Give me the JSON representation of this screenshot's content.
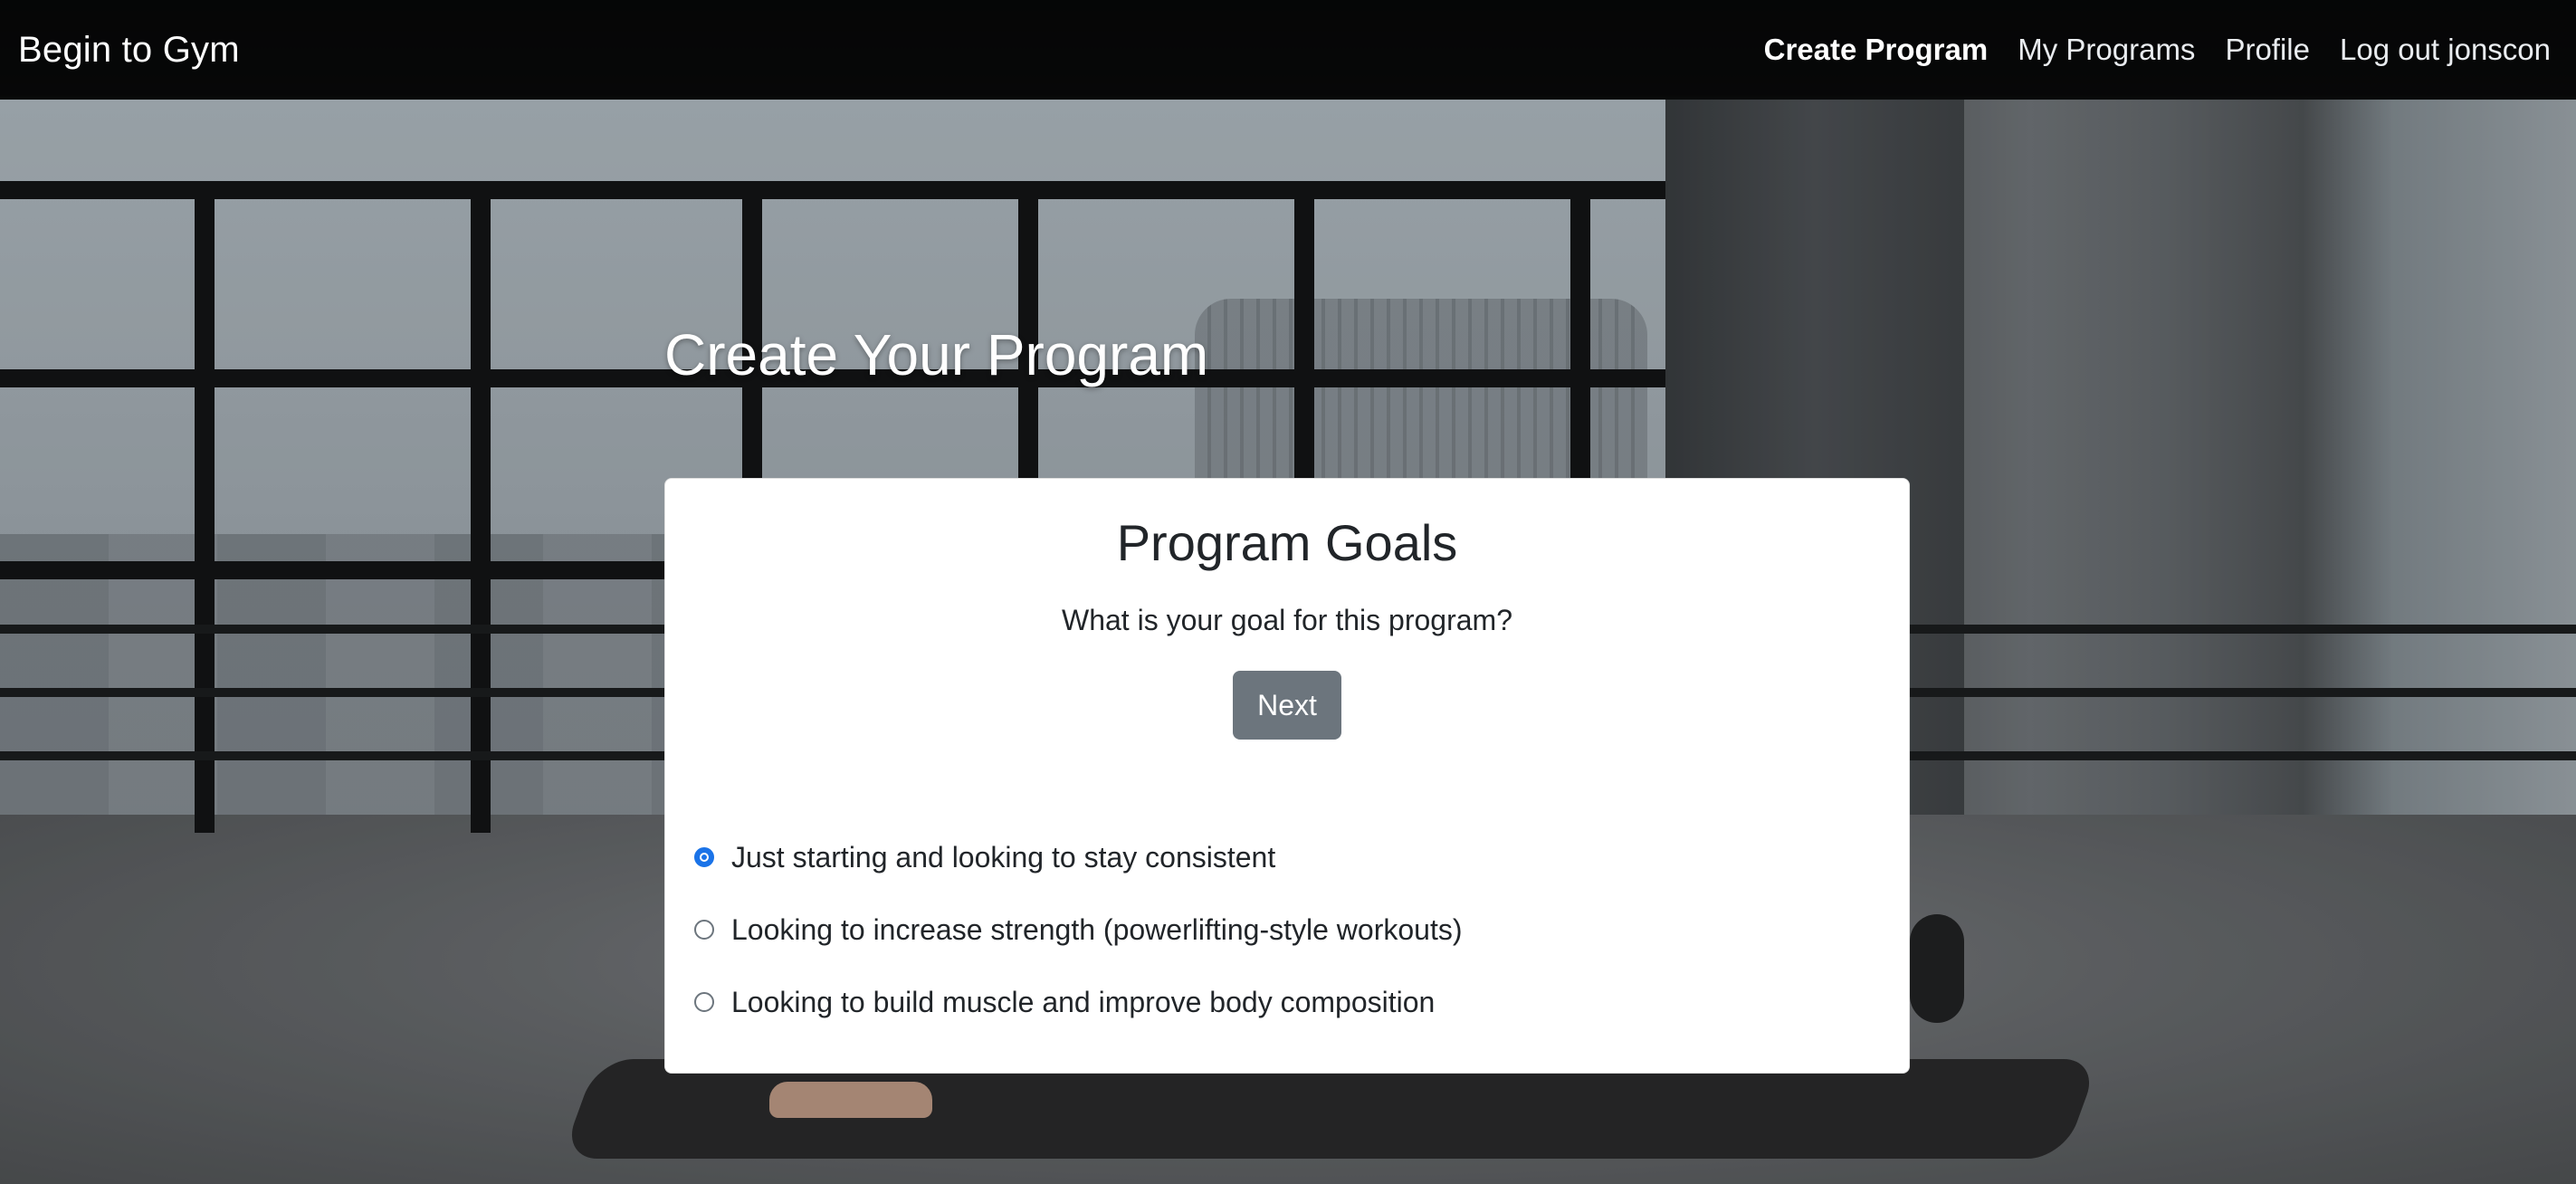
{
  "navbar": {
    "brand": "Begin to Gym",
    "links": [
      {
        "label": "Create Program",
        "active": true
      },
      {
        "label": "My Programs",
        "active": false
      },
      {
        "label": "Profile",
        "active": false
      },
      {
        "label": "Log out jonscon",
        "active": false
      }
    ]
  },
  "page": {
    "title": "Create Your Program"
  },
  "card": {
    "title": "Program Goals",
    "question": "What is your goal for this program?",
    "next_label": "Next",
    "options": [
      {
        "label": "Just starting and looking to stay consistent",
        "checked": true
      },
      {
        "label": "Looking to increase strength (powerlifting-style workouts)",
        "checked": false
      },
      {
        "label": "Looking to build muscle and improve body composition",
        "checked": false
      }
    ]
  },
  "colors": {
    "navbar_bg": "#000000",
    "button_bg": "#6c757d",
    "radio_accent": "#1a73e8",
    "card_bg": "#ffffff",
    "text": "#212529"
  },
  "icons": {
    "radio_selected": "radio-checked-icon",
    "radio_unselected": "radio-unchecked-icon"
  }
}
